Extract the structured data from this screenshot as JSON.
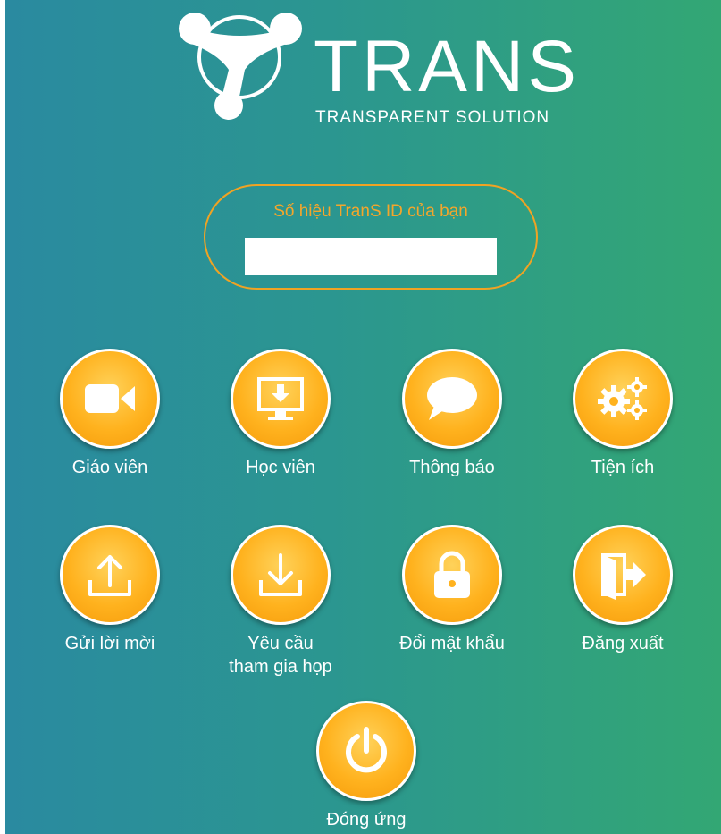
{
  "brand": {
    "name": "TRANS",
    "tagline": "TRANSPARENT SOLUTION"
  },
  "id_panel": {
    "label": "Số hiệu TranS ID của bạn",
    "value": ""
  },
  "tiles": [
    {
      "label": "Giáo viên",
      "icon": "video-camera-icon"
    },
    {
      "label": "Học viên",
      "icon": "monitor-download-icon"
    },
    {
      "label": "Thông báo",
      "icon": "chat-bubble-icon"
    },
    {
      "label": "Tiện ích",
      "icon": "gears-icon"
    },
    {
      "label": "Gửi lời mời",
      "icon": "upload-icon"
    },
    {
      "label": "Yêu cầu tham gia họp",
      "icon": "download-icon"
    },
    {
      "label": "Đổi mật khẩu",
      "icon": "lock-icon"
    },
    {
      "label": "Đăng xuất",
      "icon": "logout-door-icon"
    },
    {
      "label": "Đóng ứng",
      "icon": "power-icon"
    }
  ],
  "colors": {
    "accent": "#f0a323",
    "button_orange": "#ffb21e",
    "bg_left": "#2a8aa0",
    "bg_right": "#33a774"
  }
}
